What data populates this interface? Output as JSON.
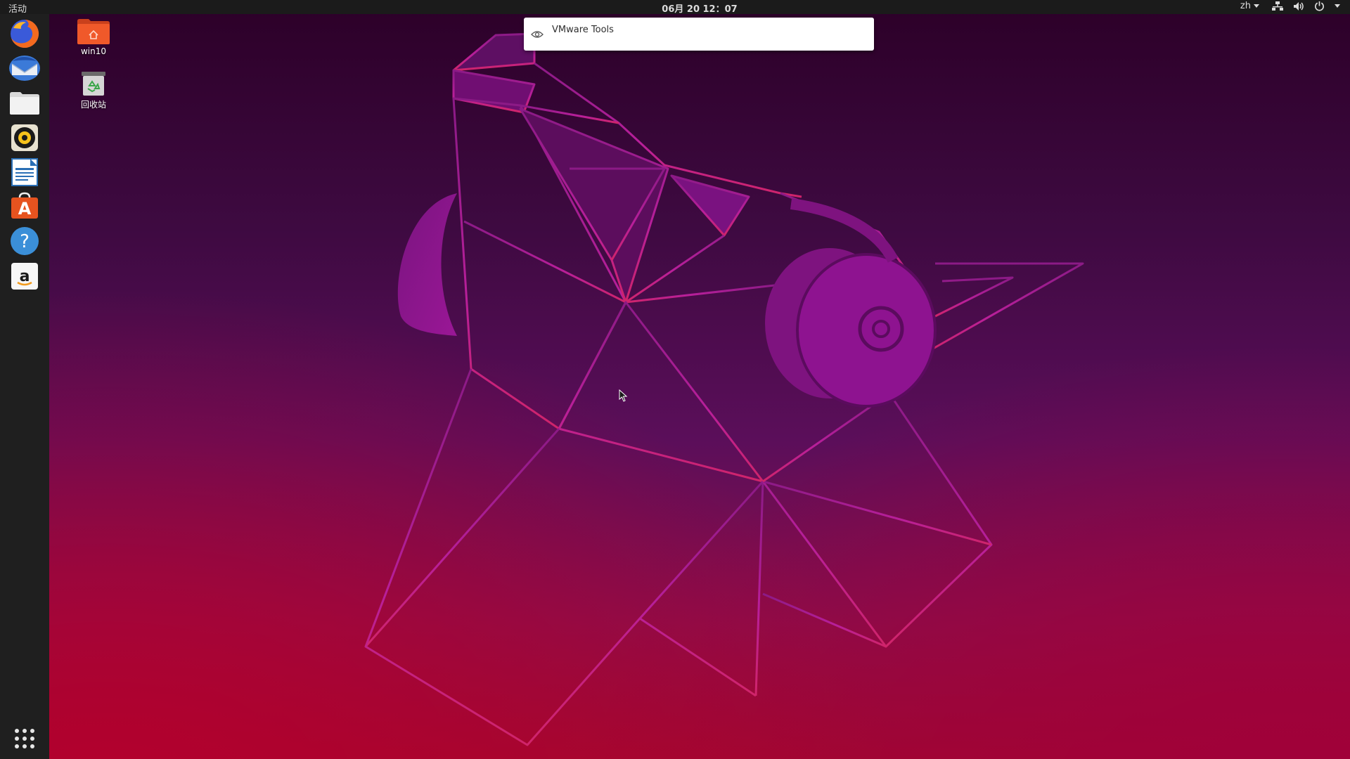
{
  "topbar": {
    "activities_label": "活动",
    "clock_text": "06月 20  12：07",
    "language_label": "zh"
  },
  "dock": {
    "items": [
      {
        "name": "firefox",
        "icon": "firefox-icon"
      },
      {
        "name": "thunderbird",
        "icon": "thunderbird-icon"
      },
      {
        "name": "files",
        "icon": "folder-icon"
      },
      {
        "name": "rhythmbox",
        "icon": "rhythmbox-icon"
      },
      {
        "name": "libreoffice-writer",
        "icon": "writer-icon"
      },
      {
        "name": "ubuntu-software",
        "icon": "software-center-icon"
      },
      {
        "name": "help",
        "icon": "help-icon"
      },
      {
        "name": "amazon",
        "icon": "amazon-icon"
      }
    ],
    "show_apps_icon": "apps-grid-icon"
  },
  "desktop": {
    "icons": [
      {
        "label": "win10",
        "icon": "home-folder-icon"
      },
      {
        "label": "回收站",
        "icon": "trash-icon"
      }
    ]
  },
  "notification": {
    "title": "VMware Tools",
    "icon": "eye-icon"
  },
  "colors": {
    "topbar_bg": "#1b1b1b",
    "dock_bg": "#1f1f1f",
    "wallpaper_dark": "#2c0028",
    "wallpaper_mid": "#5b0e5a",
    "wallpaper_red": "#a0082f",
    "line_art": "#b01d96",
    "folder_orange": "#f0592a"
  }
}
